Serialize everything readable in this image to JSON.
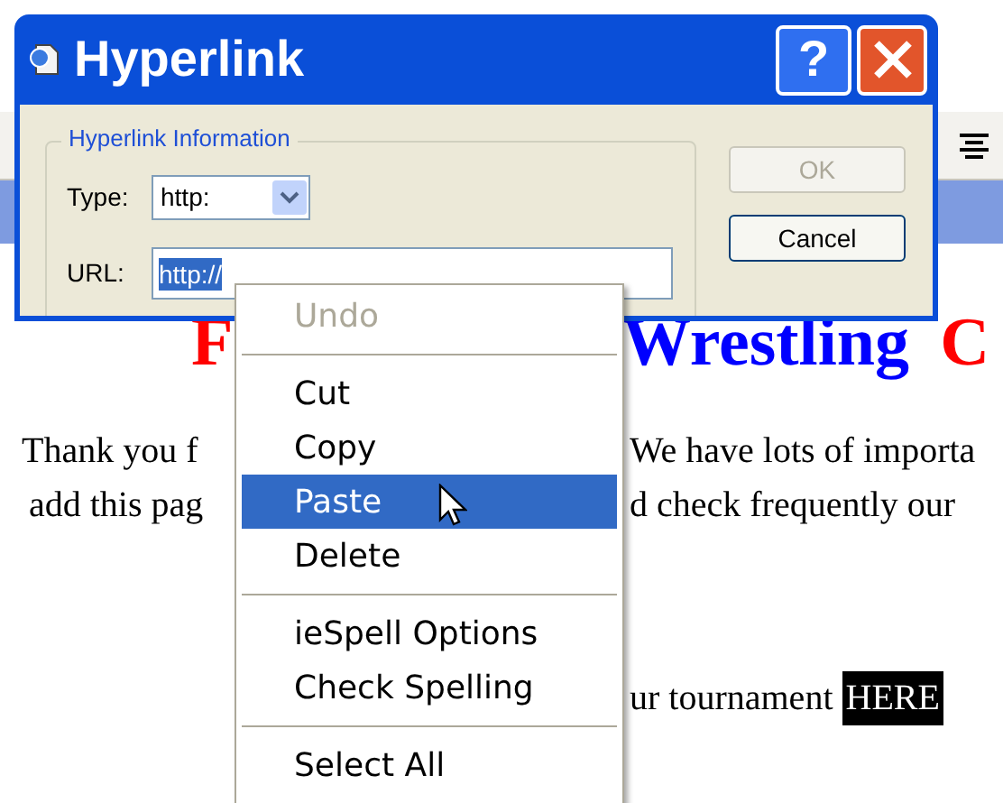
{
  "page": {
    "heading": [
      {
        "text": "F",
        "color": "#ff0000"
      },
      {
        "text": "Wrestling",
        "color": "#0000ff"
      },
      {
        "text": "C",
        "color": "#ff0000"
      }
    ],
    "lines": [
      {
        "left": "Thank you f",
        "right": "We have lots of importa"
      },
      {
        "left": "add this pag",
        "right": "d check frequently our"
      },
      {
        "right": "ur tournament",
        "link": "HERE"
      }
    ]
  },
  "window": {
    "title": "Hyperlink",
    "help": "?"
  },
  "group": {
    "legend": "Hyperlink Information"
  },
  "type_field": {
    "label": "Type:",
    "value": "http:"
  },
  "url_field": {
    "label": "URL:",
    "value": "http://",
    "text_selected": true
  },
  "buttons": [
    {
      "label": "OK",
      "disabled": true
    },
    {
      "label": "Cancel",
      "disabled": false
    }
  ],
  "context_menu": [
    {
      "kind": "item",
      "label": "Undo",
      "disabled": true,
      "selected": false
    },
    {
      "kind": "separator"
    },
    {
      "kind": "item",
      "label": "Cut",
      "disabled": false,
      "selected": false
    },
    {
      "kind": "item",
      "label": "Copy",
      "disabled": false,
      "selected": false
    },
    {
      "kind": "item",
      "label": "Paste",
      "disabled": false,
      "selected": true
    },
    {
      "kind": "item",
      "label": "Delete",
      "disabled": false,
      "selected": false
    },
    {
      "kind": "separator"
    },
    {
      "kind": "item",
      "label": "ieSpell Options",
      "disabled": false,
      "selected": false
    },
    {
      "kind": "item",
      "label": "Check Spelling",
      "disabled": false,
      "selected": false
    },
    {
      "kind": "separator"
    },
    {
      "kind": "item",
      "label": "Select All",
      "disabled": false,
      "selected": false
    }
  ]
}
